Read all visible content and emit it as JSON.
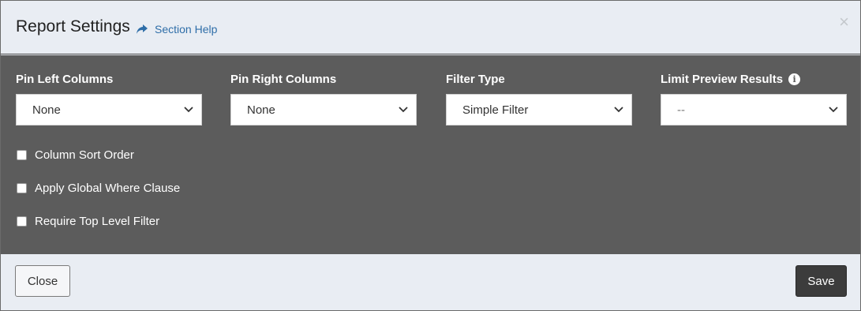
{
  "header": {
    "title": "Report Settings",
    "help_link": "Section Help",
    "close_glyph": "×"
  },
  "fields": [
    {
      "label": "Pin Left Columns",
      "value": "None"
    },
    {
      "label": "Pin Right Columns",
      "value": "None"
    },
    {
      "label": "Filter Type",
      "value": "Simple Filter"
    },
    {
      "label": "Limit Preview Results",
      "value": "--",
      "info_icon": "info-circle-icon"
    }
  ],
  "checkboxes": [
    {
      "label": "Column Sort Order",
      "checked": false
    },
    {
      "label": "Apply Global Where Clause",
      "checked": false
    },
    {
      "label": "Require Top Level Filter",
      "checked": false
    }
  ],
  "footer": {
    "close_label": "Close",
    "save_label": "Save"
  },
  "colors": {
    "header_bg": "#e9edf3",
    "body_bg": "#5c5c5c",
    "link": "#2f6ea8",
    "save_bg": "#3c3c3c"
  },
  "icons": {
    "help": "share-arrow-icon",
    "select": "chevron-down-icon"
  }
}
